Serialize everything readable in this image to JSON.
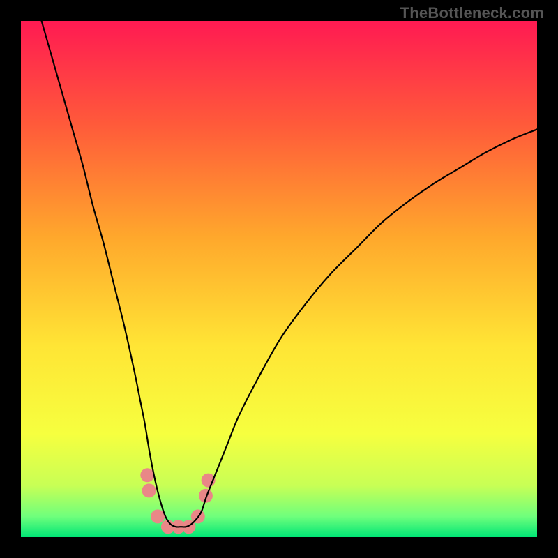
{
  "watermark": "TheBottleneck.com",
  "chart_data": {
    "type": "line",
    "title": "",
    "xlabel": "",
    "ylabel": "",
    "xlim": [
      0,
      100
    ],
    "ylim": [
      0,
      100
    ],
    "grid": false,
    "legend": false,
    "background_gradient_stops": [
      {
        "offset": 0,
        "color": "#ff1a52"
      },
      {
        "offset": 0.2,
        "color": "#ff5a3a"
      },
      {
        "offset": 0.42,
        "color": "#ffa82c"
      },
      {
        "offset": 0.63,
        "color": "#ffe535"
      },
      {
        "offset": 0.8,
        "color": "#f6ff3f"
      },
      {
        "offset": 0.9,
        "color": "#c8ff55"
      },
      {
        "offset": 0.96,
        "color": "#6fff7c"
      },
      {
        "offset": 1.0,
        "color": "#00e676"
      }
    ],
    "series": [
      {
        "name": "curve",
        "stroke": "#000000",
        "stroke_width": 2.2,
        "x": [
          4,
          6,
          8,
          10,
          12,
          14,
          16,
          18,
          20,
          22,
          23,
          24,
          25,
          26,
          27,
          28,
          29,
          30,
          31,
          32,
          33,
          34,
          35,
          36,
          38,
          40,
          42,
          45,
          50,
          55,
          60,
          65,
          70,
          75,
          80,
          85,
          90,
          95,
          100
        ],
        "y": [
          100,
          93,
          86,
          79,
          72,
          64,
          57,
          49,
          41,
          32,
          27,
          22,
          16,
          11,
          7,
          4,
          2.5,
          2,
          2,
          2,
          2.5,
          3.5,
          5,
          8,
          13,
          18,
          23,
          29,
          38,
          45,
          51,
          56,
          61,
          65,
          68.5,
          71.5,
          74.5,
          77,
          79
        ]
      }
    ],
    "markers": {
      "color": "#e98787",
      "radius": 10,
      "points": [
        {
          "x": 24.5,
          "y": 12
        },
        {
          "x": 24.8,
          "y": 9
        },
        {
          "x": 26.5,
          "y": 4
        },
        {
          "x": 28.5,
          "y": 2
        },
        {
          "x": 30.5,
          "y": 2
        },
        {
          "x": 32.5,
          "y": 2
        },
        {
          "x": 34.3,
          "y": 4
        },
        {
          "x": 35.8,
          "y": 8
        },
        {
          "x": 36.3,
          "y": 11
        }
      ]
    }
  }
}
